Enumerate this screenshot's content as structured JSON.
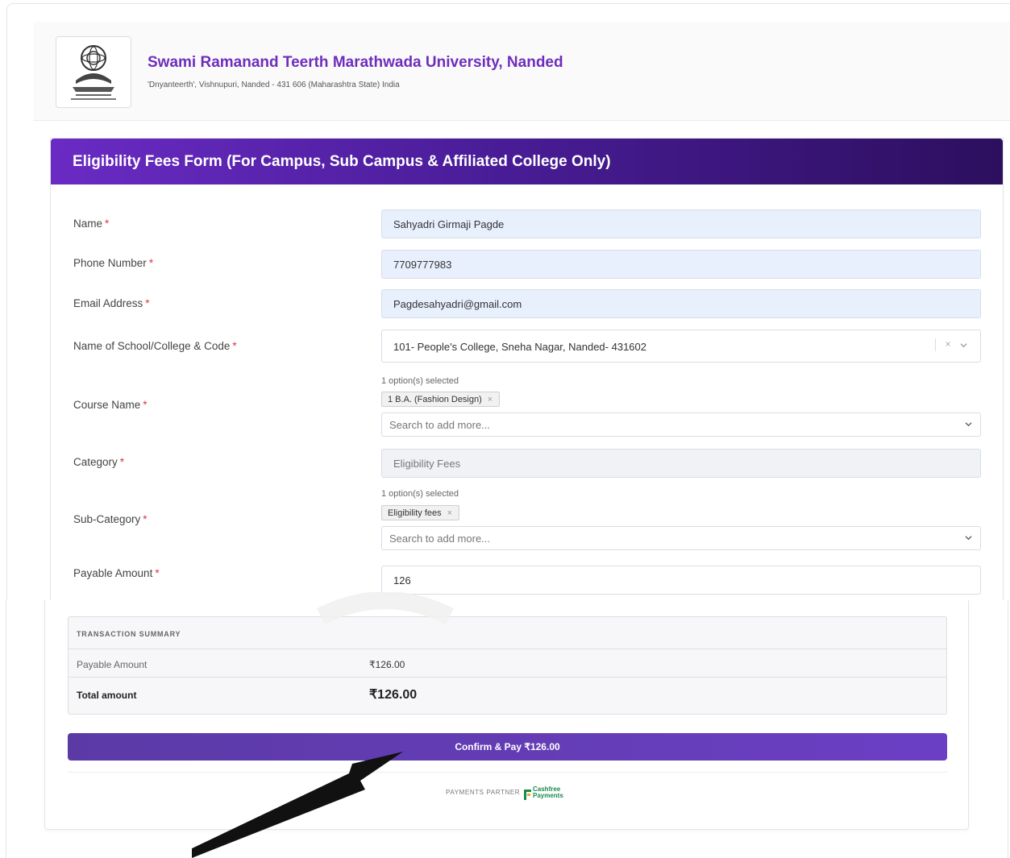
{
  "university": {
    "name": "Swami Ramanand Teerth Marathwada University, Nanded",
    "address": "'Dnyanteerth', Vishnupuri, Nanded - 431 606 (Maharashtra State) India"
  },
  "form": {
    "title": "Eligibility Fees Form (For Campus, Sub Campus & Affiliated College Only)",
    "required_mark": "*",
    "fields": {
      "name": {
        "label": "Name",
        "value": "Sahyadri Girmaji Pagde"
      },
      "phone": {
        "label": "Phone Number",
        "value": "7709777983"
      },
      "email": {
        "label": "Email Address",
        "value": "Pagdesahyadri@gmail.com"
      },
      "college": {
        "label": "Name of School/College & Code",
        "value": "101- People's College, Sneha Nagar, Nanded- 431602",
        "clear": "×"
      },
      "course": {
        "label": "Course Name",
        "count": "1 option(s) selected",
        "chip": "1 B.A. (Fashion Design)",
        "chip_remove": "×",
        "placeholder": "Search to add more..."
      },
      "category": {
        "label": "Category",
        "value": "Eligibility Fees"
      },
      "subcategory": {
        "label": "Sub-Category",
        "count": "1 option(s) selected",
        "chip": "Eligibility fees",
        "chip_remove": "×",
        "placeholder": "Search to add more..."
      },
      "amount": {
        "label": "Payable Amount",
        "value": "126"
      }
    }
  },
  "summary": {
    "heading": "TRANSACTION SUMMARY",
    "payable_label": "Payable Amount",
    "payable_value": "₹126.00",
    "total_label": "Total amount",
    "total_value": "₹126.00"
  },
  "payment": {
    "button_label": "Confirm & Pay ₹126.00",
    "partner_label": "PAYMENTS PARTNER",
    "partner_brand_line1": "Cashfree",
    "partner_brand_line2": "Payments"
  },
  "colors": {
    "brand_purple": "#6f2dbd",
    "header_gradient_start": "#6a2bc4",
    "header_gradient_end": "#2c0f5e",
    "button": "#6b3fc4",
    "required": "#dc3545",
    "cashfree_green": "#1a8a4c"
  }
}
